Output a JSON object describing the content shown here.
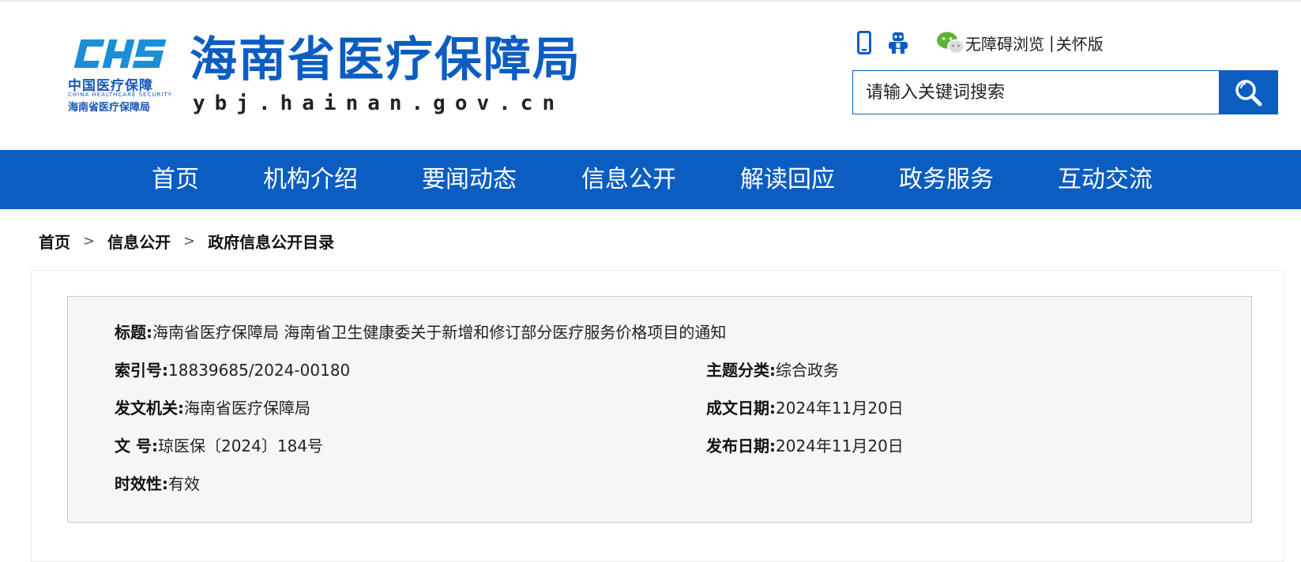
{
  "header": {
    "logo": {
      "mark": "CHS",
      "cn": "中国医疗保障",
      "en": "CHINA HEALTHCARE SECURITY",
      "sub": "海南省医疗保障局"
    },
    "site_title": "海南省医疗保障局",
    "site_domain": "ybj.hainan.gov.cn",
    "tools": {
      "icons": [
        "phone-icon",
        "robot-icon",
        "wechat-icon"
      ],
      "accessible_label": "无障碍浏览",
      "separator": "|",
      "care_label": "关怀版"
    },
    "search": {
      "placeholder": "请输入关键词搜索",
      "button_icon": "search-icon"
    }
  },
  "nav": {
    "items": [
      {
        "label": "首页"
      },
      {
        "label": "机构介绍"
      },
      {
        "label": "要闻动态"
      },
      {
        "label": "信息公开"
      },
      {
        "label": "解读回应"
      },
      {
        "label": "政务服务"
      },
      {
        "label": "互动交流"
      }
    ]
  },
  "breadcrumb": {
    "items": [
      "首页",
      "信息公开",
      "政府信息公开目录"
    ],
    "separator": ">"
  },
  "meta": {
    "title": {
      "label": "标题:",
      "value": "海南省医疗保障局 海南省卫生健康委关于新增和修订部分医疗服务价格项目的通知"
    },
    "index_no": {
      "label": "索引号:",
      "value": "18839685/2024-00180"
    },
    "topic": {
      "label": "主题分类:",
      "value": "综合政务"
    },
    "issuer": {
      "label": "发文机关:",
      "value": "海南省医疗保障局"
    },
    "written_date": {
      "label": "成文日期:",
      "value": "2024年11月20日"
    },
    "doc_no": {
      "label": "文 号:",
      "value": "琼医保〔2024〕184号"
    },
    "publish_date": {
      "label": "发布日期:",
      "value": "2024年11月20日"
    },
    "validity": {
      "label": "时效性:",
      "value": "有效"
    }
  },
  "colors": {
    "brand_blue": "#0b5dc2",
    "meta_bg": "#f6f6f6",
    "wechat_green": "#5fb236"
  }
}
